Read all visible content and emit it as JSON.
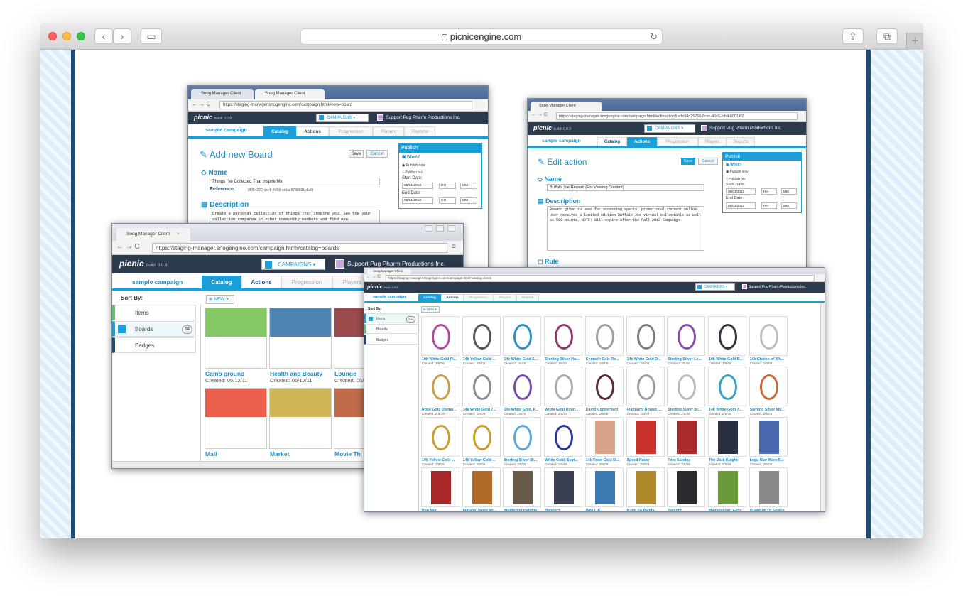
{
  "browser": {
    "url": "picnicengine.com"
  },
  "screens": {
    "board": {
      "tabs": [
        "Snog Manager Client",
        "Snog Manager Client"
      ],
      "url": "https://staging-manager.snogengine.com/campaign.html#new=board",
      "logo": "picnic",
      "build": "build: 0.0.9",
      "campaigns_label": "CAMPAIGNS",
      "org": "Support Pug Pharm Productions Inc.",
      "campaign_name": "sample campaign",
      "nav": [
        "Catalog",
        "Actions",
        "Progression",
        "Players",
        "Reports"
      ],
      "title": "Add new Board",
      "save": "Save",
      "cancel": "Cancel",
      "name_label": "Name",
      "name_value": "Things I've Collected That Inspire Me",
      "ref_label": "Reference:",
      "ref_value": "8f054229-cbe8-4d68-ad1a-8735591c6af3",
      "desc_label": "Description",
      "desc_value": "Create a personal collection of things that inspire you. See how your collection compares to other community members and find new",
      "publish": {
        "title": "Publish",
        "when": "When?",
        "now": "Publish now",
        "on": "Publish on:",
        "start": "Start Date:",
        "end": "End Date:",
        "date": "08/01/2013",
        "hh": "HH",
        "mm": "MM"
      }
    },
    "action": {
      "tab": "Snog Manager Client",
      "url": "https://staging-manager.snogengine.com/campaign.html#edit=action&ref=94d25760-8cac-46c6-bfb4-60014f2",
      "logo": "picnic",
      "build": "build: 0.0.9",
      "campaigns_label": "CAMPAIGNS",
      "org": "Support Pug Pharm Productions Inc.",
      "campaign_name": "sample campaign",
      "nav": [
        "Catalog",
        "Actions",
        "Progression",
        "Players",
        "Reports"
      ],
      "title": "Edit action",
      "save": "Save",
      "cancel": "Cancel",
      "name_label": "Name",
      "name_value": "Buffalo Joe Reward (For Viewing Content)",
      "desc_label": "Description",
      "desc_value": "Reward given to user for accessing special promotional content online. User receives a limited edition Buffalo Joe virtual collectable as well as 500 points. NOTE: Will expire after the Fall 2013 Campaign",
      "rule_label": "Rule",
      "publish": {
        "title": "Publish",
        "when": "When?",
        "now": "Publish now",
        "on": "Publish on:",
        "start": "Start Date:",
        "end": "End Date:",
        "date": "08/01/2013",
        "hh": "HH",
        "mm": "MM"
      }
    },
    "boards": {
      "tab": "Snog Manager Client",
      "url": "https://staging-manager.snogengine.com/campaign.html#catalog=boards",
      "logo": "picnic",
      "build": "build: 0.0.9",
      "campaigns_label": "CAMPAIGNS",
      "org": "Support Pug Pharm Productions Inc.",
      "campaign_name": "sample campaign",
      "nav": [
        "Catalog",
        "Actions",
        "Progression",
        "Players"
      ],
      "sort_by": "Sort By:",
      "side": [
        {
          "label": "Items",
          "count": ""
        },
        {
          "label": "Boards",
          "count": "34"
        },
        {
          "label": "Badges",
          "count": ""
        }
      ],
      "new_label": "NEW",
      "cards": [
        {
          "name": "Camp ground",
          "date": "Created: 05/12/11",
          "color": "#6fbf4a"
        },
        {
          "name": "Health and Beauty",
          "date": "Created: 05/12/11",
          "color": "#2e6ea3"
        },
        {
          "name": "Lounge",
          "date": "Created: 05/12/11",
          "color": "#8a2b2b"
        },
        {
          "name": "Mall",
          "date": "",
          "color": "#e8432e"
        },
        {
          "name": "Market",
          "date": "",
          "color": "#c8a83a"
        },
        {
          "name": "Movie Th",
          "date": "",
          "color": "#b5512a"
        }
      ]
    },
    "items": {
      "tab": "Snog Manager Client",
      "url": "https://staging-manager.snogengine.com/campaign.html#catalog=items",
      "logo": "picnic",
      "build": "build: 0.0.9",
      "campaigns_label": "CAMPAIGNS",
      "org": "Support Pug Pharm Productions Inc.",
      "campaign_name": "sample campaign",
      "nav": [
        "Catalog",
        "Actions",
        "Progression",
        "Players",
        "Reports"
      ],
      "sort_by": "Sort By:",
      "side": [
        {
          "label": "Items",
          "count": "344"
        },
        {
          "label": "Boards",
          "count": ""
        },
        {
          "label": "Badges",
          "count": ""
        }
      ],
      "new_label": "NEW",
      "created": "Created: 2/6/09",
      "grid": [
        {
          "name": "10k White Gold Pi...",
          "color": "#b04a9b"
        },
        {
          "name": "14k Yellow Gold ...",
          "color": "#555555"
        },
        {
          "name": "14k White Gold S...",
          "color": "#2d8fc8"
        },
        {
          "name": "Sterling Silver Ha...",
          "color": "#8b3a6d"
        },
        {
          "name": "Kenneth Cole Re...",
          "color": "#9aa0a6"
        },
        {
          "name": "14k White Gold D...",
          "color": "#7a7f86"
        },
        {
          "name": "Sterling Silver Le...",
          "color": "#8a4bb0"
        },
        {
          "name": "10k White Gold B...",
          "color": "#333344"
        },
        {
          "name": "14k Choice of Wh...",
          "color": "#b9bec4"
        },
        {
          "name": "Rose Gold Diamo...",
          "color": "#c8a04a"
        },
        {
          "name": "14k White Gold 7...",
          "color": "#888c92"
        },
        {
          "name": "10k White Gold, P...",
          "color": "#7a4bb0"
        },
        {
          "name": "White Gold Roun...",
          "color": "#a8adb3"
        },
        {
          "name": "David Copperfield",
          "color": "#5b2a3a"
        },
        {
          "name": "Platinum, Round, ...",
          "color": "#9a9ea4"
        },
        {
          "name": "Sterling Silver Br...",
          "color": "#b7bbc0"
        },
        {
          "name": "14k White Gold 7...",
          "color": "#3aa0c8"
        },
        {
          "name": "Sterling Silver Mu...",
          "color": "#c86a3a"
        },
        {
          "name": "10k Yellow Gold ...",
          "color": "#c8a032"
        },
        {
          "name": "14k Yellow Gold ...",
          "color": "#c89a28"
        },
        {
          "name": "Sterling Silver Bl...",
          "color": "#58a8d8"
        },
        {
          "name": "White Gold, Sept...",
          "color": "#2a3a9a"
        },
        {
          "name": "14k Rose Gold Di...",
          "color": "#d8a28a"
        },
        {
          "name": "Speed Racer",
          "color": "#c8322a"
        },
        {
          "name": "First Sunday",
          "color": "#a82a2a"
        },
        {
          "name": "The Dark Knight",
          "color": "#2a3040"
        },
        {
          "name": "Lego Star Wars R...",
          "color": "#4a6ab0"
        },
        {
          "name": "Iron Man",
          "color": "#a8282a"
        },
        {
          "name": "Indiana Jones an...",
          "color": "#b06a2a"
        },
        {
          "name": "Wuthering Heights",
          "color": "#6a5a4a"
        },
        {
          "name": "Hancock",
          "color": "#3a4050"
        },
        {
          "name": "WALL-E",
          "color": "#3a7ab0"
        },
        {
          "name": "Kung Fu Panda",
          "color": "#b08a2a"
        },
        {
          "name": "Twilight",
          "color": "#2a2a30"
        },
        {
          "name": "Madagascar: Esca...",
          "color": "#6a9a3a"
        },
        {
          "name": "Quantum Of Solace",
          "color": "#8a8a8a"
        }
      ]
    }
  }
}
